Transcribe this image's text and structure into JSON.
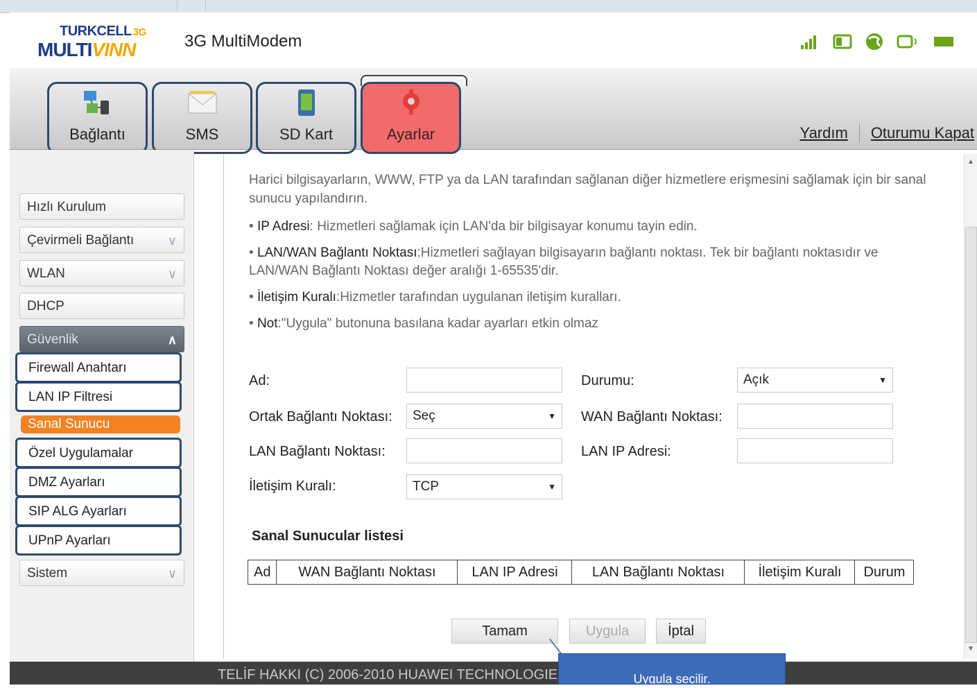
{
  "header": {
    "logo_line1": "TURKCELL",
    "logo_3g": "3G",
    "logo_line2_a": "MULTI",
    "logo_line2_b": "VINN",
    "app_title": "3G MultiModem",
    "status_icons": [
      "signal-icon",
      "sim-icon",
      "globe-icon",
      "wifi-icon",
      "battery-icon"
    ]
  },
  "nav": {
    "tabs": [
      {
        "label": "Bağlantı",
        "icon": "connection-icon"
      },
      {
        "label": "SMS",
        "icon": "envelope-icon"
      },
      {
        "label": "SD Kart",
        "icon": "sd-card-icon"
      },
      {
        "label": "Ayarlar",
        "icon": "gear-icon"
      }
    ],
    "help": "Yardım",
    "logout": "Oturumu Kapat"
  },
  "sidebar": {
    "items": [
      {
        "label": "Hızlı Kurulum"
      },
      {
        "label": "Çevirmeli Bağlantı"
      },
      {
        "label": "WLAN"
      },
      {
        "label": "DHCP"
      },
      {
        "label": "Güvenlik"
      }
    ],
    "security_items": [
      {
        "label": "Firewall Anahtarı"
      },
      {
        "label": "LAN IP Filtresi"
      },
      {
        "label": "Sanal Sunucu"
      },
      {
        "label": "Özel Uygulamalar"
      },
      {
        "label": "DMZ Ayarları"
      },
      {
        "label": "SIP ALG Ayarları"
      },
      {
        "label": "UPnP Ayarları"
      }
    ],
    "system": "Sistem"
  },
  "content": {
    "intro": "Harici bilgisayarların, WWW, FTP ya da LAN tarafından sağlanan diğer hizmetlere erişmesini sağlamak için bir sanal sunucu yapılandırın.",
    "bullets": [
      {
        "term": "IP Adresi",
        "text": ": Hizmetleri sağlamak için LAN'da bir bilgisayar konumu tayin edin."
      },
      {
        "term": "LAN/WAN Bağlantı Noktası",
        "text": ":Hizmetleri sağlayan bilgisayarın bağlantı noktası. Tek bir bağlantı noktasıdır ve LAN/WAN Bağlantı Noktası değer aralığı 1-65535'dir."
      },
      {
        "term": "İletişim Kuralı",
        "text": ":Hizmetler tarafından uygulanan iletişim kuralları."
      },
      {
        "term": "Not",
        "text": ":\"Uygula\" butonuna basılana kadar ayarları etkin olmaz"
      }
    ],
    "form": {
      "ad_label": "Ad:",
      "ad_value": "",
      "durum_label": "Durumu:",
      "durum_value": "Açık",
      "ortak_label": "Ortak Bağlantı Noktası:",
      "ortak_value": "Seç",
      "wan_label": "WAN Bağlantı Noktası:",
      "wan_value": "",
      "lan_port_label": "LAN Bağlantı Noktası:",
      "lan_port_value": "",
      "lan_ip_label": "LAN IP Adresi:",
      "lan_ip_value": "",
      "protocol_label": "İletişim Kuralı:",
      "protocol_value": "TCP"
    },
    "list_title": "Sanal Sunucular listesi",
    "table_headers": [
      "Ad",
      "WAN Bağlantı Noktası",
      "LAN IP Adresi",
      "LAN Bağlantı Noktası",
      "İletişim Kuralı",
      "Durum"
    ],
    "buttons": {
      "ok": "Tamam",
      "apply": "Uygula",
      "cancel": "İptal"
    }
  },
  "footer": {
    "copyright": "TELİF HAKKI (C) 2006-2010 HUAWEI TECHNOLOGIES"
  },
  "callout": {
    "text": "Uygula seçilir."
  },
  "colors": {
    "active_tab": "#f26b6b",
    "active_sub": "#f58220",
    "highlight_border": "#2d4a6d",
    "callout": "#3e6bb8"
  }
}
